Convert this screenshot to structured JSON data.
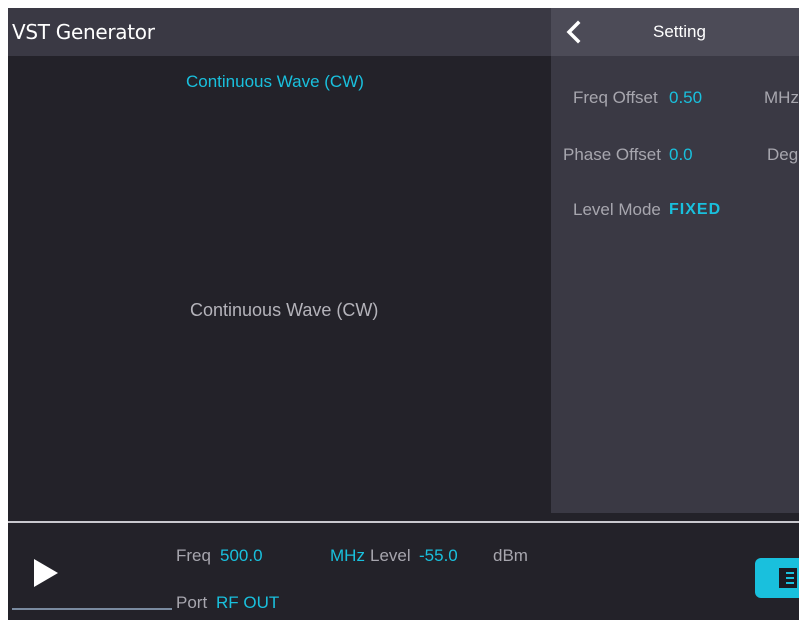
{
  "app": {
    "title": "VST Generator"
  },
  "settings": {
    "back_icon": "chevron-left-icon",
    "title": "Setting",
    "freq_offset": {
      "label": "Freq Offset",
      "value": "0.50",
      "unit": "MHz"
    },
    "phase_offset": {
      "label": "Phase Offset",
      "value": "0.0",
      "unit": "Deg"
    },
    "level_mode": {
      "label": "Level Mode",
      "value": "FIXED"
    }
  },
  "main": {
    "mode_header": "Continuous Wave (CW)",
    "mode_center": "Continuous Wave (CW)"
  },
  "bottom": {
    "play_icon": "play-icon",
    "freq": {
      "label": "Freq",
      "value": "500.0",
      "unit": "MHz"
    },
    "level": {
      "label": "Level",
      "value": "-55.0",
      "unit": "dBm"
    },
    "port": {
      "label": "Port",
      "value": "RF OUT"
    },
    "menu_icon": "menu-list-icon"
  },
  "colors": {
    "accent": "#19c0dd",
    "background": "#232229",
    "panel": "#3a3944",
    "panel_header": "#4c4b57",
    "label": "#a7a6ae",
    "text": "#ffffff"
  }
}
